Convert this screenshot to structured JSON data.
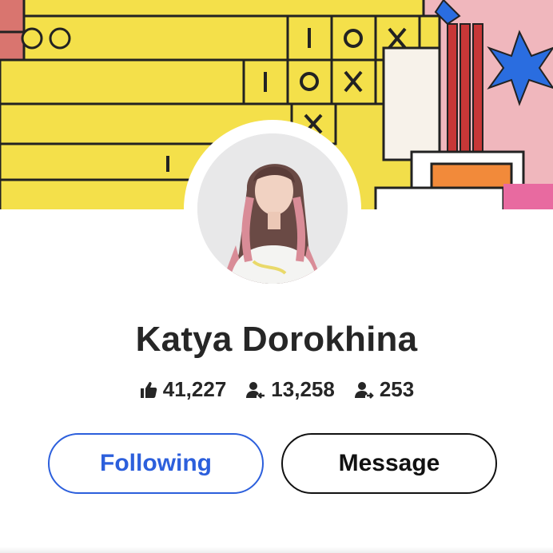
{
  "profile": {
    "name": "Katya Dorokhina",
    "stats": [
      {
        "icon": "thumbs-up-icon",
        "value": "41,227"
      },
      {
        "icon": "followers-icon",
        "value": "13,258"
      },
      {
        "icon": "following-icon",
        "value": "253"
      }
    ]
  },
  "actions": {
    "following_label": "Following",
    "message_label": "Message"
  },
  "colors": {
    "accent": "#2c5fdc",
    "text": "#262626",
    "cover_yellow": "#f2de4a",
    "cover_pink": "#f0b7bd",
    "cover_blue": "#2a6de0"
  }
}
